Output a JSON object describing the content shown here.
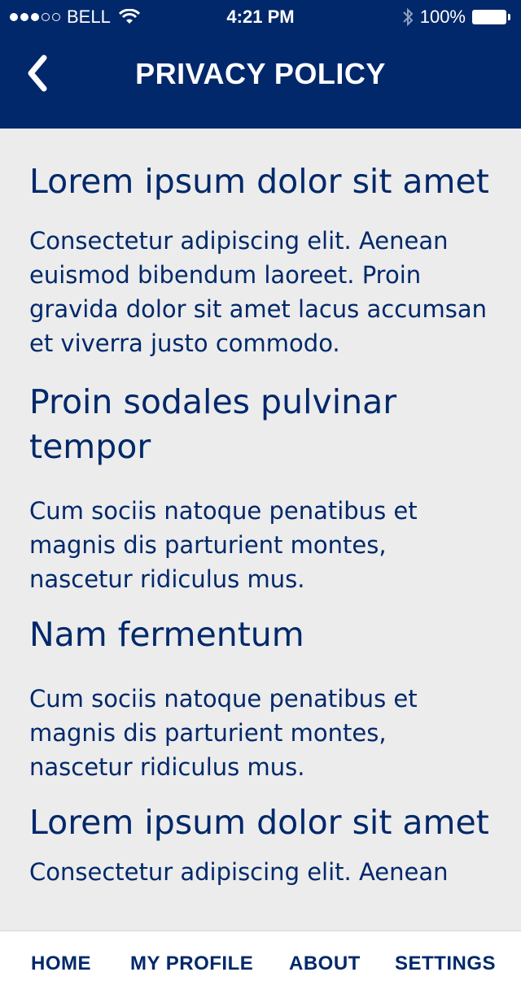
{
  "status_bar": {
    "carrier": "BELL",
    "time": "4:21 PM",
    "battery": "100%",
    "signal_strength": 3,
    "signal_max": 5
  },
  "nav": {
    "title": "PRIVACY POLICY",
    "back_icon": "chevron-left-icon"
  },
  "sections": [
    {
      "heading": "Lorem ipsum dolor sit amet",
      "body": "Consectetur adipiscing elit. Aenean euismod bibendum laoreet. Proin gravida dolor sit amet lacus accumsan et viverra justo commodo."
    },
    {
      "heading": "Proin sodales pulvinar tempor",
      "body": "Cum sociis natoque penatibus et magnis dis parturient montes, nascetur ridiculus mus."
    },
    {
      "heading": "Nam fermentum",
      "body": "Cum sociis natoque penatibus et magnis dis parturient montes, nascetur ridiculus mus."
    },
    {
      "heading": "Lorem ipsum dolor sit amet",
      "body": "Consectetur adipiscing elit. Aenean"
    }
  ],
  "tabs": [
    {
      "label": "HOME"
    },
    {
      "label": "MY PROFILE"
    },
    {
      "label": "ABOUT"
    },
    {
      "label": "SETTINGS"
    }
  ],
  "colors": {
    "brand": "#00286a",
    "background": "#ececec",
    "tab_bar": "#ffffff"
  }
}
